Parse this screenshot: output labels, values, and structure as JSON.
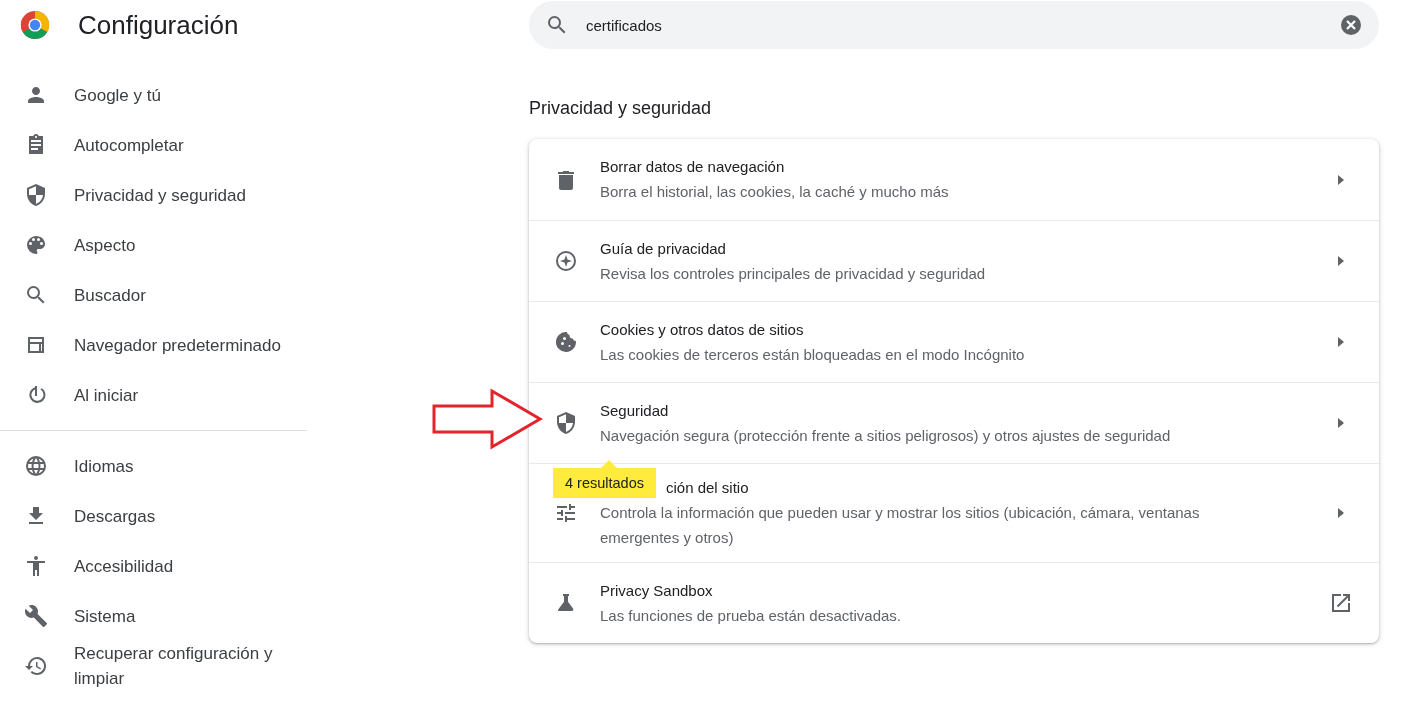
{
  "header": {
    "title": "Configuración"
  },
  "search": {
    "value": "certificados"
  },
  "sidebar": {
    "groups": [
      [
        {
          "label": "Google y tú"
        },
        {
          "label": "Autocompletar"
        },
        {
          "label": "Privacidad y seguridad"
        },
        {
          "label": "Aspecto"
        },
        {
          "label": "Buscador"
        },
        {
          "label": "Navegador predeterminado"
        },
        {
          "label": "Al iniciar"
        }
      ],
      [
        {
          "label": "Idiomas"
        },
        {
          "label": "Descargas"
        },
        {
          "label": "Accesibilidad"
        },
        {
          "label": "Sistema"
        },
        {
          "label": "Recuperar configuración y limpiar"
        }
      ]
    ]
  },
  "section": {
    "heading": "Privacidad y seguridad",
    "rows": [
      {
        "kind": "subpage",
        "title": "Borrar datos de navegación",
        "description": "Borra el historial, las cookies, la caché y mucho más"
      },
      {
        "kind": "subpage",
        "title": "Guía de privacidad",
        "description": "Revisa los controles principales de privacidad y seguridad"
      },
      {
        "kind": "subpage",
        "title": "Cookies y otros datos de sitios",
        "description": "Las cookies de terceros están bloqueadas en el modo Incógnito"
      },
      {
        "kind": "subpage",
        "title": "Seguridad",
        "description": "Navegación segura (protección frente a sitios peligrosos) y otros ajustes de seguridad",
        "badge": "4 resultados"
      },
      {
        "kind": "subpage",
        "title": "ción del sitio",
        "description": "Controla la información que pueden usar y mostrar los sitios (ubicación, cámara, ventanas emergentes y otros)"
      },
      {
        "kind": "external",
        "title": "Privacy Sandbox",
        "description": "Las funciones de prueba están desactivadas."
      }
    ]
  }
}
